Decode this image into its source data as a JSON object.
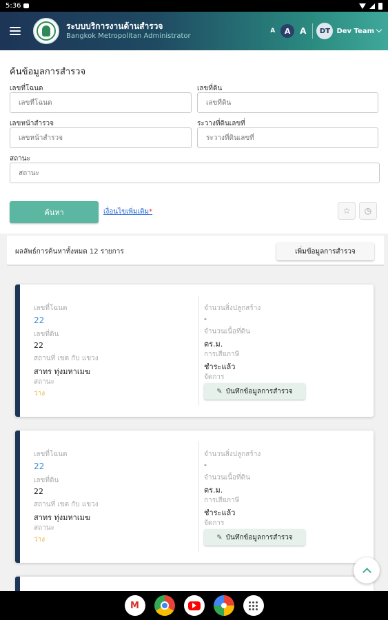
{
  "status_bar": {
    "time": "5:36"
  },
  "header": {
    "title": "ระบบบริการงานด้านสำรวจ",
    "subtitle": "Bangkok Metropolitan Administrator",
    "font_small": "A",
    "font_medium": "A",
    "font_large": "A",
    "user_initials": "DT",
    "user_name": "Dev Team"
  },
  "search": {
    "title": "ค้นข้อมูลการสำรวจ",
    "fields": [
      {
        "label": "เลขที่โฉนด",
        "placeholder": "เลขที่โฉนด"
      },
      {
        "label": "เลขที่ดิน",
        "placeholder": "เลขที่ดิน"
      },
      {
        "label": "เลขหน้าสำรวจ",
        "placeholder": "เลขหน้าสำรวจ"
      },
      {
        "label": "ระวางที่ดินเลขที่",
        "placeholder": "ระวางที่ดินเลขที่"
      },
      {
        "label": "สถานะ",
        "placeholder": "สถานะ"
      }
    ],
    "search_button": "ค้นหา",
    "more_link": "เงื่อนไขเพิ่มเติม",
    "more_link_marker": "*",
    "star_icon": "☆",
    "history_icon": "◷"
  },
  "results": {
    "summary": "ผลลัพธ์การค้นหาทั้งหมด 12 รายการ",
    "add_button": "เพิ่มข้อมูลการสำรวจ",
    "cards": [
      {
        "deed_label": "เลขที่โฉนด",
        "deed_value": "22",
        "land_label": "เลขที่ดิน",
        "land_value": "22",
        "location_label": "สถานที่ เขต กับ แขวง",
        "location_value": "สาทร ทุ่งมหาเมฆ",
        "status_label": "สถานะ",
        "status_value": "ว่าง",
        "buildings_label": "จำนวนสิ่งปลูกสร้าง",
        "buildings_value": "-",
        "area_label": "จำนวนเนื้อที่ดิน",
        "area_value": "ตร.ม.",
        "tax_label": "การเสียภาษี",
        "tax_value": "ชำระแล้ว",
        "manage_label": "จัดการ",
        "record_button": "บันทึกข้อมูลการสำรวจ"
      },
      {
        "deed_label": "เลขที่โฉนด",
        "deed_value": "22",
        "land_label": "เลขที่ดิน",
        "land_value": "22",
        "location_label": "สถานที่ เขต กับ แขวง",
        "location_value": "สาทร ทุ่งมหาเมฆ",
        "status_label": "สถานะ",
        "status_value": "ว่าง",
        "buildings_label": "จำนวนสิ่งปลูกสร้าง",
        "buildings_value": "-",
        "area_label": "จำนวนเนื้อที่ดิน",
        "area_value": "ตร.ม.",
        "tax_label": "การเสียภาษี",
        "tax_value": "ชำระแล้ว",
        "manage_label": "จัดการ",
        "record_button": "บันทึกข้อมูลการสำรวจ"
      }
    ]
  },
  "taskbar": {
    "gmail_glyph": "M"
  },
  "colors": {
    "primary": "#5bb7a2",
    "navy": "#1d3557",
    "link": "#3b8ed6",
    "status": "#e9b33a"
  }
}
